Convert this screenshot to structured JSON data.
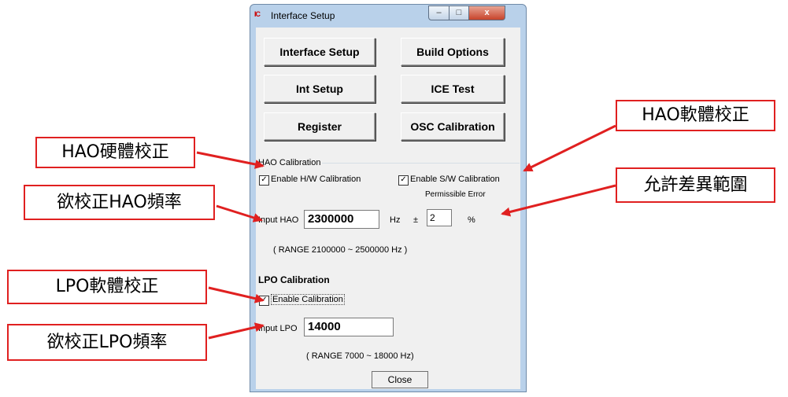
{
  "window": {
    "app_icon_text": "IC",
    "title": "Interface Setup",
    "min_glyph": "–",
    "max_glyph": "□",
    "close_glyph": "x"
  },
  "buttons": {
    "interface_setup": "Interface Setup",
    "build_options": "Build Options",
    "int_setup": "Int Setup",
    "ice_test": "ICE Test",
    "register": "Register",
    "osc_calibration": "OSC Calibration",
    "close": "Close"
  },
  "hao": {
    "group_label": "HAO Calibration",
    "enable_hw_label": "Enable H/W Calibration",
    "enable_hw_checked": true,
    "enable_sw_label": "Enable S/W Calibration",
    "enable_sw_checked": true,
    "permissible_error_label": "Permissible Error",
    "input_label": "Input HAO",
    "input_value": "2300000",
    "unit_hz": "Hz",
    "plus_minus": "±",
    "error_value": "2",
    "percent": "%",
    "range_text": "( RANGE  2100000  ~    2500000   Hz )"
  },
  "lpo": {
    "group_label": "LPO Calibration",
    "enable_label": "Enable Calibration",
    "enable_checked": true,
    "input_label": "Input LPO",
    "input_value": "14000",
    "range_text": "( RANGE 7000      ~  18000     Hz)"
  },
  "annotations": {
    "hao_hw": "HAO硬體校正",
    "hao_sw": "HAO軟體校正",
    "hao_freq": "欲校正HAO頻率",
    "permissible": "允許差異範圍",
    "lpo_sw": "LPO軟體校正",
    "lpo_freq": "欲校正LPO頻率"
  },
  "colors": {
    "annotation_border": "#e02020",
    "arrow": "#e02020",
    "window_frame": "#b9d1ea"
  },
  "icons": {
    "check": "✓"
  }
}
